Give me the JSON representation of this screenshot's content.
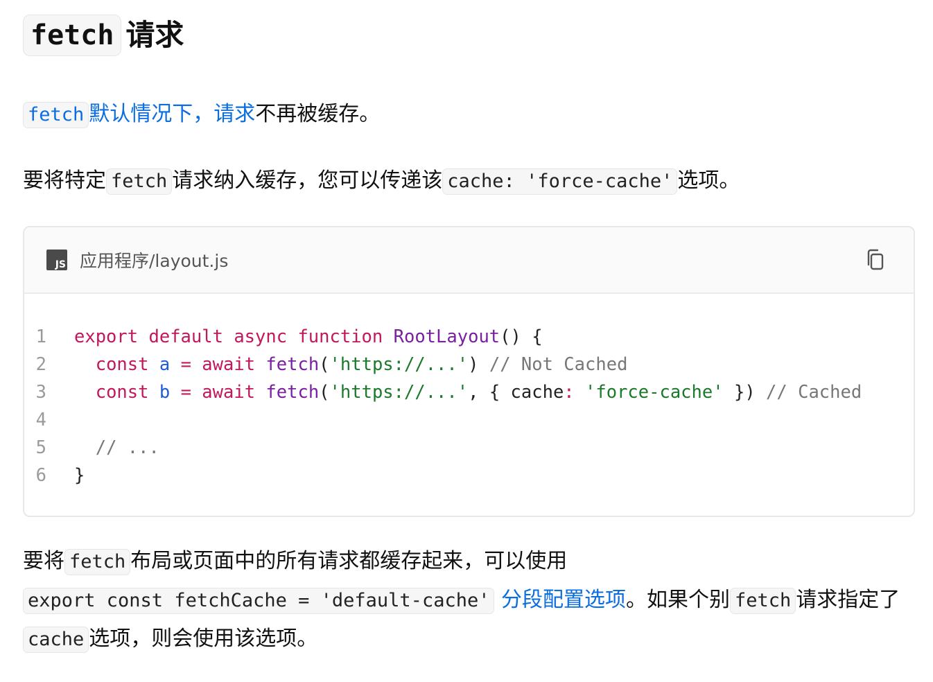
{
  "heading": {
    "code": "fetch",
    "text": "请求"
  },
  "para1": {
    "link_code": "fetch",
    "link_text": "默认情况下，请求",
    "tail": "不再被缓存。"
  },
  "para2": {
    "t1": "要将特定",
    "c1": "fetch",
    "t2": "请求纳入缓存，您可以传递该",
    "c2": "cache: 'force-cache'",
    "t3": "选项。"
  },
  "code_block": {
    "filename": "应用程序/layout.js",
    "badge": "JS",
    "copy_icon": "copy-icon",
    "line_numbers": [
      "1",
      "2",
      "3",
      "4",
      "5",
      "6"
    ],
    "lines": [
      [
        {
          "t": "export",
          "c": "kw"
        },
        {
          "t": " "
        },
        {
          "t": "default",
          "c": "kw"
        },
        {
          "t": " "
        },
        {
          "t": "async",
          "c": "kw"
        },
        {
          "t": " "
        },
        {
          "t": "function",
          "c": "kw"
        },
        {
          "t": " "
        },
        {
          "t": "RootLayout",
          "c": "fn"
        },
        {
          "t": "() {"
        }
      ],
      [
        {
          "t": "  "
        },
        {
          "t": "const",
          "c": "kw"
        },
        {
          "t": " "
        },
        {
          "t": "a",
          "c": "var"
        },
        {
          "t": " "
        },
        {
          "t": "=",
          "c": "op"
        },
        {
          "t": " "
        },
        {
          "t": "await",
          "c": "kw"
        },
        {
          "t": " "
        },
        {
          "t": "fetch",
          "c": "fn"
        },
        {
          "t": "("
        },
        {
          "t": "'https://...'",
          "c": "str"
        },
        {
          "t": ") "
        },
        {
          "t": "// Not Cached",
          "c": "com"
        }
      ],
      [
        {
          "t": "  "
        },
        {
          "t": "const",
          "c": "kw"
        },
        {
          "t": " "
        },
        {
          "t": "b",
          "c": "var"
        },
        {
          "t": " "
        },
        {
          "t": "=",
          "c": "op"
        },
        {
          "t": " "
        },
        {
          "t": "await",
          "c": "kw"
        },
        {
          "t": " "
        },
        {
          "t": "fetch",
          "c": "fn"
        },
        {
          "t": "("
        },
        {
          "t": "'https://...'",
          "c": "str"
        },
        {
          "t": ", { cache"
        },
        {
          "t": ":",
          "c": "op"
        },
        {
          "t": " "
        },
        {
          "t": "'force-cache'",
          "c": "str"
        },
        {
          "t": " }) "
        },
        {
          "t": "// Cached",
          "c": "com"
        }
      ],
      [
        {
          "t": " "
        }
      ],
      [
        {
          "t": "  "
        },
        {
          "t": "// ...",
          "c": "com"
        }
      ],
      [
        {
          "t": "}"
        }
      ]
    ]
  },
  "para3": {
    "t1": "要将",
    "c1": "fetch",
    "t2": "布局或页面中的所有请求都缓存起来，可以使用",
    "c2": "export const fetchCache = 'default-cache'",
    "link": "分段配置选项",
    "t3": "。如果个别",
    "c3": "fetch",
    "t4": "请求指定了",
    "c4": "cache",
    "t5": "选项，则会使用该选项。"
  }
}
